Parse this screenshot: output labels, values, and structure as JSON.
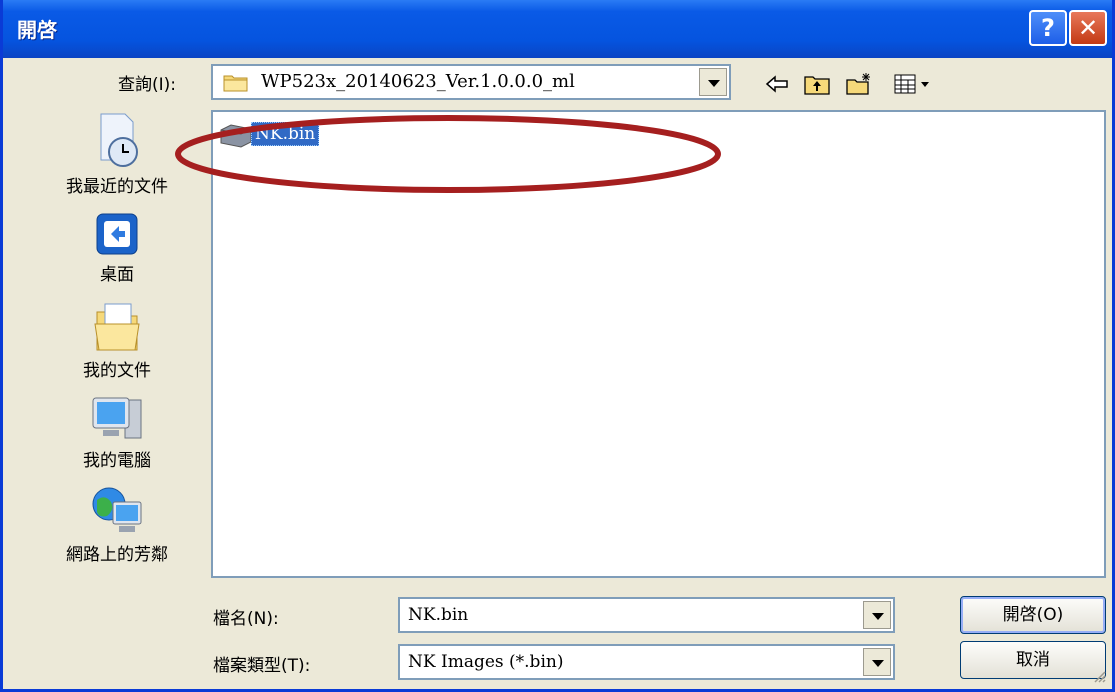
{
  "window": {
    "title": "開啓",
    "help_symbol": "?",
    "close_symbol": "✕"
  },
  "lookin": {
    "label": "查詢(I):",
    "value": "WP523x_20140623_Ver.1.0.0.0_ml",
    "icon": "folder-icon"
  },
  "toolbar": {
    "icons": [
      "back-arrow-icon",
      "up-folder-icon",
      "new-folder-icon",
      "view-menu-icon"
    ]
  },
  "places": [
    {
      "label": "我最近的文件",
      "icon": "recent-documents-icon"
    },
    {
      "label": "桌面",
      "icon": "desktop-icon"
    },
    {
      "label": "我的文件",
      "icon": "my-documents-icon"
    },
    {
      "label": "我的電腦",
      "icon": "my-computer-icon"
    },
    {
      "label": "網路上的芳鄰",
      "icon": "network-places-icon"
    }
  ],
  "files": [
    {
      "name": "NK.bin",
      "selected": true,
      "icon": "binary-file-icon"
    }
  ],
  "annotation": {
    "shape": "ellipse",
    "color": "#a51f1f"
  },
  "filename": {
    "label": "檔名(N):",
    "value": "NK.bin"
  },
  "filetype": {
    "label": "檔案類型(T):",
    "value": "NK Images (*.bin)"
  },
  "buttons": {
    "open": "開啓(O)",
    "cancel": "取消"
  },
  "colors": {
    "title_bar": "#0554df",
    "selection": "#316ac5",
    "field_border": "#7f9db9",
    "dialog_bg": "#ece9d8"
  }
}
